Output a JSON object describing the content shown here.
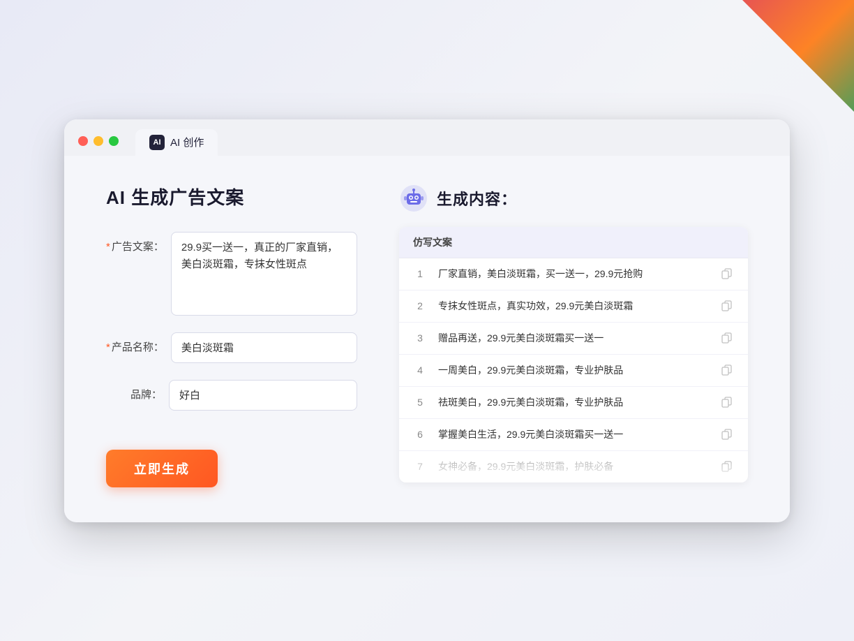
{
  "window": {
    "tab_label": "AI 创作",
    "tab_icon_text": "AI"
  },
  "left": {
    "page_title": "AI 生成广告文案",
    "fields": [
      {
        "label": "广告文案：",
        "required": true,
        "type": "textarea",
        "value": "29.9买一送一，真正的厂家直销，美白淡斑霜，专抹女性斑点",
        "name": "ad-copy-textarea"
      },
      {
        "label": "产品名称：",
        "required": true,
        "type": "input",
        "value": "美白淡斑霜",
        "name": "product-name-input"
      },
      {
        "label": "品牌：",
        "required": false,
        "type": "input",
        "value": "好白",
        "name": "brand-input"
      }
    ],
    "generate_btn": "立即生成"
  },
  "right": {
    "title": "生成内容：",
    "column_header": "仿写文案",
    "results": [
      {
        "num": "1",
        "text": "厂家直销，美白淡斑霜，买一送一，29.9元抢购",
        "faded": false
      },
      {
        "num": "2",
        "text": "专抹女性斑点，真实功效，29.9元美白淡斑霜",
        "faded": false
      },
      {
        "num": "3",
        "text": "赠品再送，29.9元美白淡斑霜买一送一",
        "faded": false
      },
      {
        "num": "4",
        "text": "一周美白，29.9元美白淡斑霜，专业护肤品",
        "faded": false
      },
      {
        "num": "5",
        "text": "祛斑美白，29.9元美白淡斑霜，专业护肤品",
        "faded": false
      },
      {
        "num": "6",
        "text": "掌握美白生活，29.9元美白淡斑霜买一送一",
        "faded": false
      },
      {
        "num": "7",
        "text": "女神必备，29.9元美白淡斑霜，护肤必备",
        "faded": true
      }
    ]
  },
  "colors": {
    "accent": "#ff5722",
    "primary": "#7c7cf0"
  }
}
